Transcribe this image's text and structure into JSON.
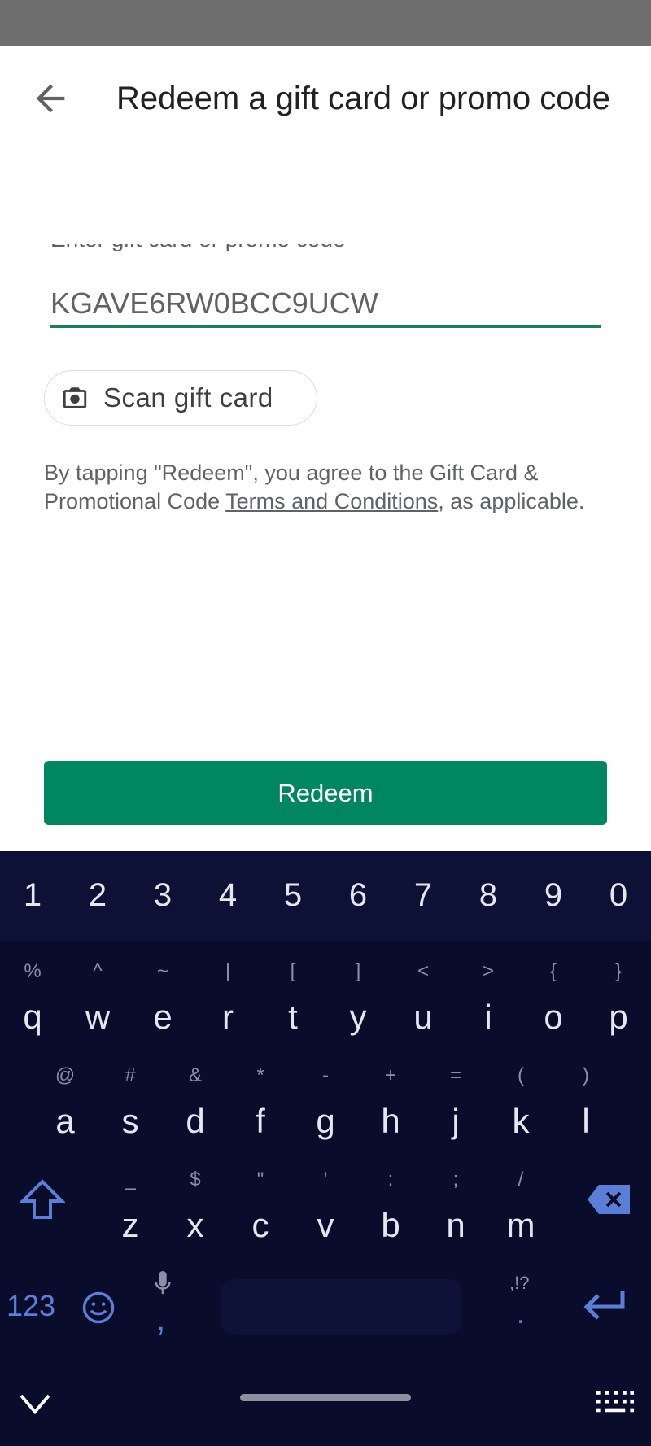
{
  "header": {
    "title": "Redeem a gift card or promo code",
    "back_icon": "arrow-left-icon"
  },
  "form": {
    "field_label_partial": "Enter gift card or promo code",
    "code_value": "KGAVE6RW0BCC9UCW",
    "scan_label": "Scan gift card",
    "terms_prefix": "By tapping \"Redeem\", you agree to the Gift Card & Promotional Code ",
    "terms_link": "Terms and Conditions",
    "terms_suffix": ", as applicable.",
    "redeem_label": "Redeem"
  },
  "colors": {
    "accent": "#01875f",
    "keyboard_bg": "#090c2b",
    "keyboard_blue": "#5b7fd6"
  },
  "keyboard": {
    "numbers": [
      "1",
      "2",
      "3",
      "4",
      "5",
      "6",
      "7",
      "8",
      "9",
      "0"
    ],
    "row1": {
      "letters": [
        "q",
        "w",
        "e",
        "r",
        "t",
        "y",
        "u",
        "i",
        "o",
        "p"
      ],
      "hints": [
        "%",
        "^",
        "~",
        "|",
        "[",
        "]",
        "<",
        ">",
        "{",
        "}"
      ]
    },
    "row2": {
      "letters": [
        "a",
        "s",
        "d",
        "f",
        "g",
        "h",
        "j",
        "k",
        "l"
      ],
      "hints": [
        "@",
        "#",
        "&",
        "*",
        "-",
        "+",
        "=",
        "(",
        ")"
      ]
    },
    "row3": {
      "letters": [
        "z",
        "x",
        "c",
        "v",
        "b",
        "n",
        "m"
      ],
      "hints": [
        "_",
        "$",
        "\"",
        "'",
        ":",
        ";",
        "/"
      ]
    },
    "symbols_label": "123",
    "comma": ",",
    "period": ".",
    "punct_hint": ",!?"
  }
}
